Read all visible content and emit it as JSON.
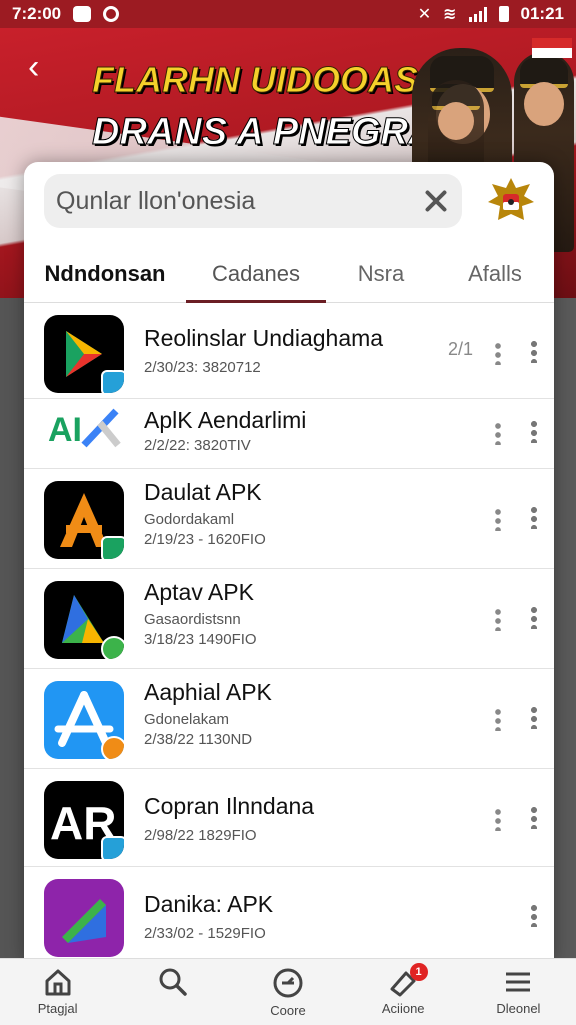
{
  "status_bar": {
    "time": "7:2:00",
    "clock_right": "01:21"
  },
  "banner": {
    "line1": "FLARHN UIDOOASIAI",
    "line2": "DRANS A PNEGRA!"
  },
  "search": {
    "value": "Qunlar llon'onesia"
  },
  "tabs": [
    {
      "label": "Ndndonsan"
    },
    {
      "label": "Cadanes"
    },
    {
      "label": "Nsra"
    },
    {
      "label": "Afalls"
    }
  ],
  "apps": [
    {
      "title": "Reolinslar Undiaghama",
      "line1": "",
      "line2": "2/30/23: 3820712",
      "count": "2/1",
      "icon": "play-store-icon",
      "colors": [
        "#000000",
        "#e8332c",
        "#f7b500",
        "#1aa260"
      ]
    },
    {
      "title": "AplK Aendarlimi",
      "line1": "",
      "line2": "2/2/22: 3820TIV",
      "count": "",
      "icon": "ai-pen-icon",
      "colors": [
        "#ffffff",
        "#1aa260",
        "#3b82f6"
      ]
    },
    {
      "title": "Daulat APK",
      "line1": "Godordakaml",
      "line2": "2/19/23 - 1620FIO",
      "count": "",
      "icon": "a-letter-icon",
      "colors": [
        "#000000",
        "#f08c16"
      ]
    },
    {
      "title": "Aptav APK",
      "line1": "Gasaordistsnn",
      "line2": "3/18/23 1490FIO",
      "count": "",
      "icon": "triangle-icon",
      "colors": [
        "#000000",
        "#3cb34a",
        "#2f6fe0"
      ]
    },
    {
      "title": "Aaphial APK",
      "line1": "Gdonelakam",
      "line2": "2/38/22 1130ND",
      "count": "",
      "icon": "app-store-icon",
      "colors": [
        "#2196f3",
        "#ffffff"
      ]
    },
    {
      "title": "Copran Ilnndana",
      "line1": "",
      "line2": "2/98/22 1829FIO",
      "count": "",
      "icon": "ar-letter-icon",
      "colors": [
        "#000000",
        "#ffffff"
      ]
    },
    {
      "title": "Danika: APK",
      "line1": "",
      "line2": "2/33/02 - 1529FIO",
      "count": "",
      "icon": "purple-app-icon",
      "colors": [
        "#8e24aa",
        "#3cb34a"
      ]
    }
  ],
  "nav": [
    {
      "label": "Ptagjal",
      "icon": "home-icon"
    },
    {
      "label": "",
      "icon": "search-icon"
    },
    {
      "label": "Coore",
      "icon": "compass-icon"
    },
    {
      "label": "Aciione",
      "icon": "tag-icon",
      "badge": "1"
    },
    {
      "label": "Dleonel",
      "icon": "menu-icon"
    }
  ]
}
